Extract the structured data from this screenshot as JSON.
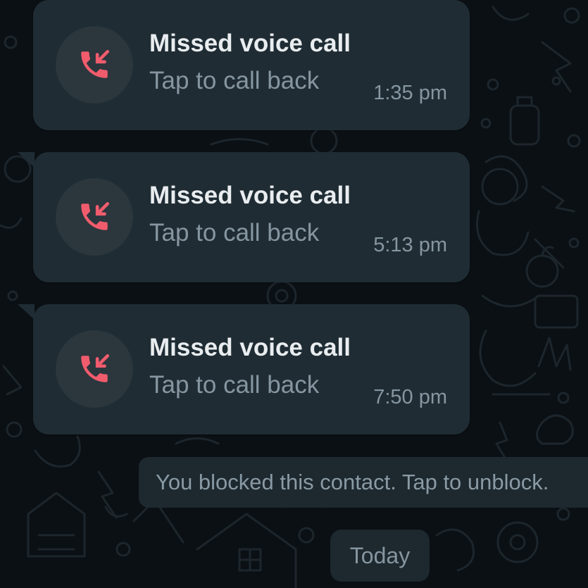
{
  "theme": {
    "background": "#0b1014",
    "bubble": "#1f2c34",
    "missed_icon_color": "#f15c6d",
    "primary_text": "#e9edef",
    "secondary_text": "#8696a0"
  },
  "messages": [
    {
      "icon": "missed-call-icon",
      "title": "Missed voice call",
      "subtitle": "Tap to call back",
      "time": "1:35 pm"
    },
    {
      "icon": "missed-call-icon",
      "title": "Missed voice call",
      "subtitle": "Tap to call back",
      "time": "5:13 pm"
    },
    {
      "icon": "missed-call-icon",
      "title": "Missed voice call",
      "subtitle": "Tap to call back",
      "time": "7:50 pm"
    }
  ],
  "system_message": "You blocked this contact. Tap to unblock.",
  "date_divider": "Today"
}
